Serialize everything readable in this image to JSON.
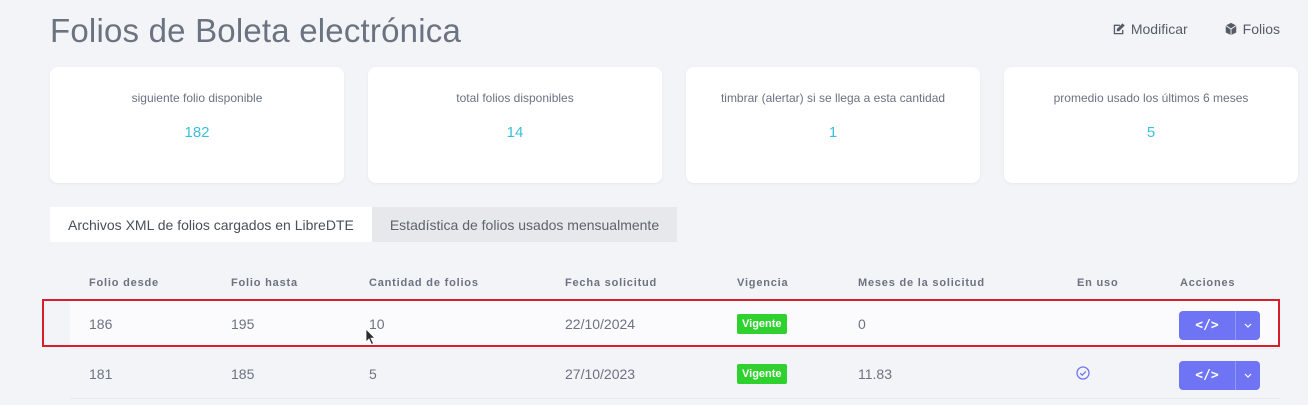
{
  "page": {
    "title": "Folios de Boleta electrónica"
  },
  "top_actions": [
    {
      "label": "Modificar",
      "icon": "edit-icon"
    },
    {
      "label": "Folios",
      "icon": "cube-icon"
    }
  ],
  "stats": [
    {
      "label": "siguiente folio disponible",
      "value": "182"
    },
    {
      "label": "total folios disponibles",
      "value": "14"
    },
    {
      "label": "timbrar (alertar) si se llega a esta cantidad",
      "value": "1"
    },
    {
      "label": "promedio usado los últimos 6 meses",
      "value": "5"
    }
  ],
  "tabs": [
    {
      "label": "Archivos XML de folios cargados en LibreDTE",
      "active": true
    },
    {
      "label": "Estadística de folios usados mensualmente",
      "active": false
    }
  ],
  "table": {
    "columns": [
      "Folio desde",
      "Folio hasta",
      "Cantidad de folios",
      "Fecha solicitud",
      "Vigencia",
      "Meses de la solicitud",
      "En uso",
      "Acciones"
    ],
    "rows": [
      {
        "desde": "186",
        "hasta": "195",
        "cantidad": "10",
        "fecha": "22/10/2024",
        "vigencia": "Vigente",
        "meses": "0",
        "en_uso": false,
        "action": "</>"
      },
      {
        "desde": "181",
        "hasta": "185",
        "cantidad": "5",
        "fecha": "27/10/2023",
        "vigencia": "Vigente",
        "meses": "11.83",
        "en_uso": true,
        "action": "</>"
      }
    ]
  },
  "colors": {
    "accent": "#3bbfd8",
    "badge": "#2fd12f",
    "button": "#6f74f5",
    "highlight": "#d81e2a"
  }
}
